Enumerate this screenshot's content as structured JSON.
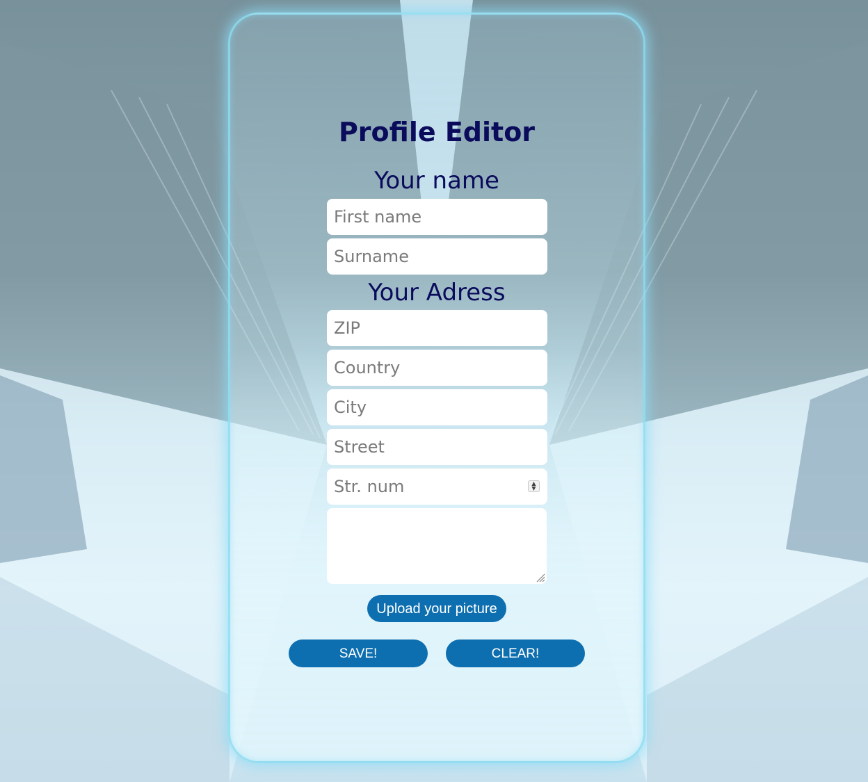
{
  "page": {
    "title": "Profile Editor"
  },
  "name_section": {
    "heading": "Your name",
    "first_name_placeholder": "First name",
    "surname_placeholder": "Surname"
  },
  "address_section": {
    "heading": "Your Adress",
    "zip_placeholder": "ZIP",
    "country_placeholder": "Country",
    "city_placeholder": "City",
    "street_placeholder": "Street",
    "street_number_placeholder": "Str. num"
  },
  "buttons": {
    "upload_label": "Upload your picture",
    "save_label": "SAVE!",
    "clear_label": "CLEAR!"
  },
  "colors": {
    "heading": "#0b0b5c",
    "button_bg": "#0e6fb0",
    "button_text": "#ffffff",
    "card_glow": "#8cdcf0"
  }
}
